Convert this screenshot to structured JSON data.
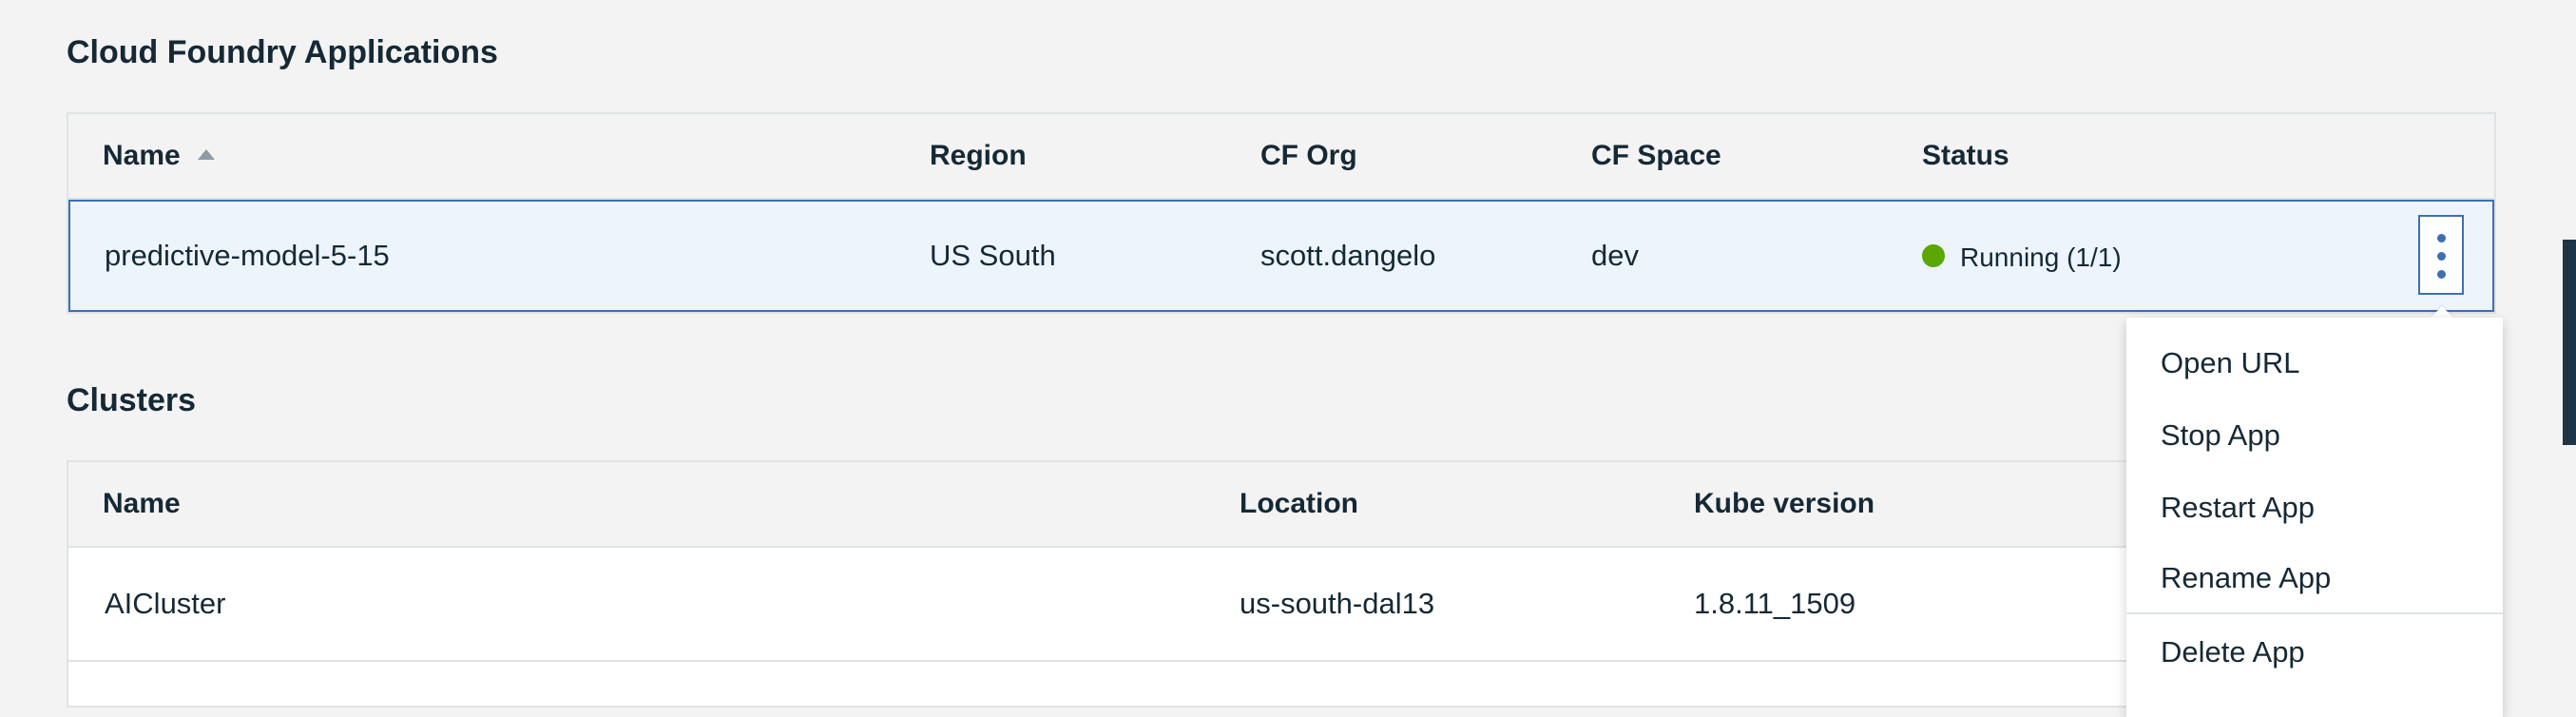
{
  "cf_section": {
    "title": "Cloud Foundry Applications",
    "columns": [
      "Name",
      "Region",
      "CF Org",
      "CF Space",
      "Status"
    ],
    "rows": [
      {
        "name": "predictive-model-5-15",
        "region": "US South",
        "cf_org": "scott.dangelo",
        "cf_space": "dev",
        "status": "Running (1/1)",
        "status_color": "#5aa700"
      }
    ]
  },
  "clusters_section": {
    "title": "Clusters",
    "columns": [
      "Name",
      "Location",
      "Kube version"
    ],
    "rows": [
      {
        "name": "AICluster",
        "location": "us-south-dal13",
        "kube_version": "1.8.11_1509"
      }
    ]
  },
  "overflow_menu": {
    "items": [
      "Open URL",
      "Stop App",
      "Restart App",
      "Rename App",
      "Delete App"
    ]
  },
  "colors": {
    "accent": "#3d70b2",
    "status_running": "#5aa700",
    "selected_row": "#edf4fc",
    "text": "#152935"
  },
  "icons": {
    "sort": "sort-ascending-icon",
    "overflow": "overflow-menu-vertical-icon",
    "status": "status-dot-icon"
  }
}
